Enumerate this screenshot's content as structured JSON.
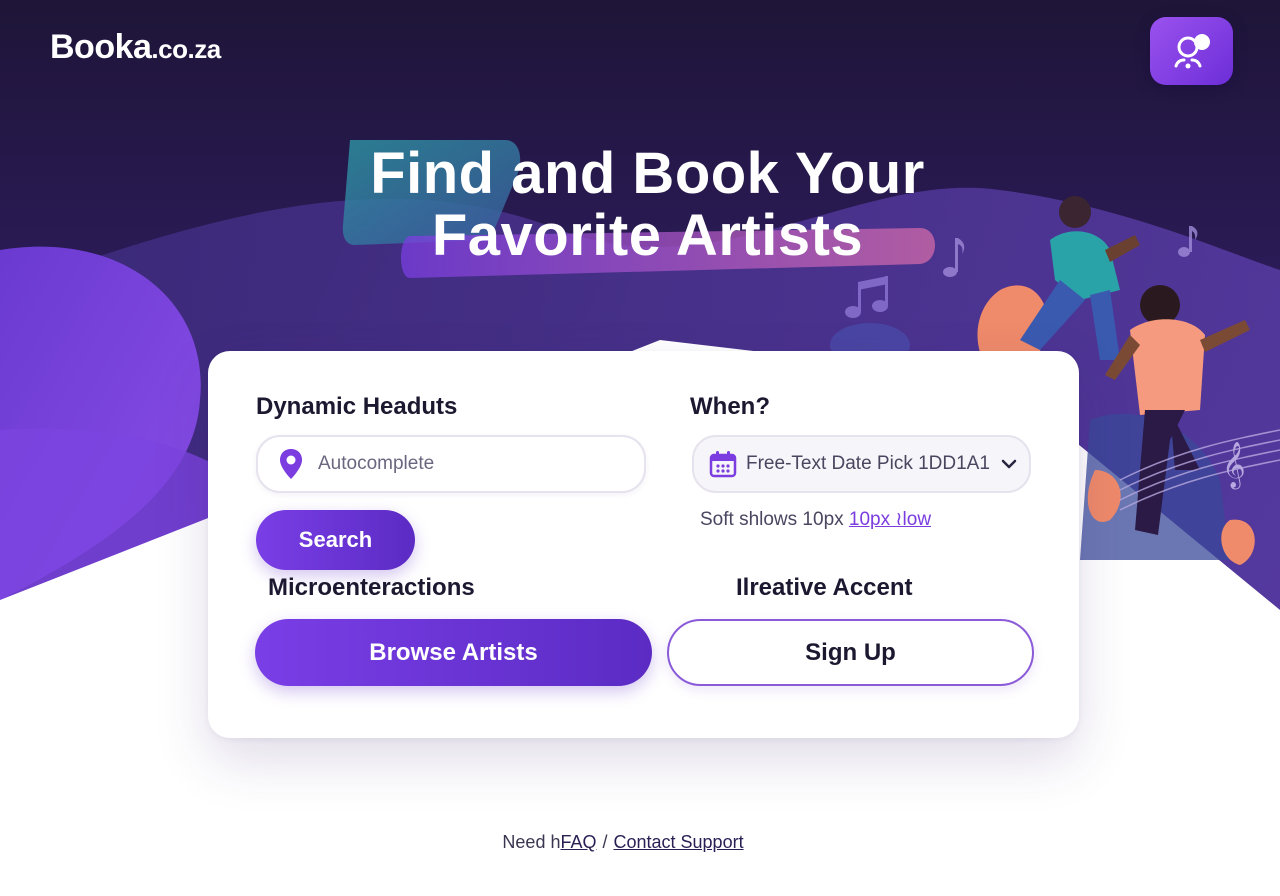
{
  "header": {
    "brand": "Booka",
    "tld": ".co.za",
    "app_icon": "people-icon"
  },
  "hero": {
    "title_line1": "Find and Book Your",
    "title_line2": "Favorite Artists"
  },
  "search_card": {
    "where_label": "Dynamic Headuts",
    "where_placeholder": "Autocomplete",
    "where_icon": "location-pin-icon",
    "when_label": "When?",
    "date_value": "Free-Text Date Pick 1DD1A1",
    "date_icon": "calendar-icon",
    "hint_text": "Soft shlows 10px",
    "hint_link": "10px ≀low",
    "search_button": "Search",
    "micro_label": "Microenteractions",
    "accent_label": "Ilreative Accent",
    "browse_button": "Browse Artists",
    "signup_button": "Sign Up"
  },
  "footer": {
    "prefix": "Need h",
    "faq": "FAQ",
    "separator": "/",
    "contact": "Contact Support"
  },
  "colors": {
    "hero_dark": "#1f1540",
    "hero_purple": "#6a35c8",
    "accent": "#7a3ee6",
    "teal": "#2a9aa8",
    "coral": "#f08a6a"
  }
}
